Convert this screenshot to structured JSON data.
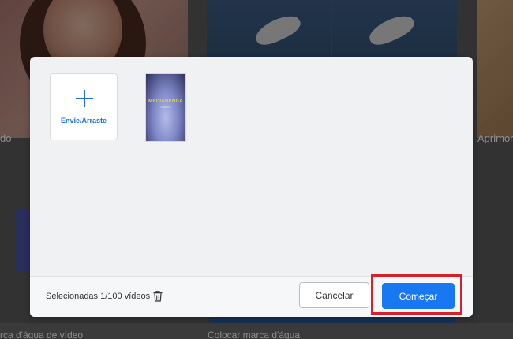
{
  "background": {
    "labels": {
      "left_mid": "do",
      "right_mid": "Aprimor",
      "bottom_left": "rca d'água de vídeo",
      "bottom_mid": "Colocar marca d'água"
    }
  },
  "modal": {
    "upload_tile": {
      "label": "Envie/Arraste",
      "icon": "plus-icon"
    },
    "thumbnail": {
      "title": "MEDIABENDA",
      "subtitle": "CREDITS"
    },
    "footer": {
      "selected_text": "Selecionadas 1/100  vídeos",
      "trash_icon": "trash-icon",
      "cancel_label": "Cancelar",
      "start_label": "Começar"
    }
  },
  "colors": {
    "accent": "#1778f2",
    "highlight": "#d8202a",
    "upload_text": "#1f6fd6"
  }
}
